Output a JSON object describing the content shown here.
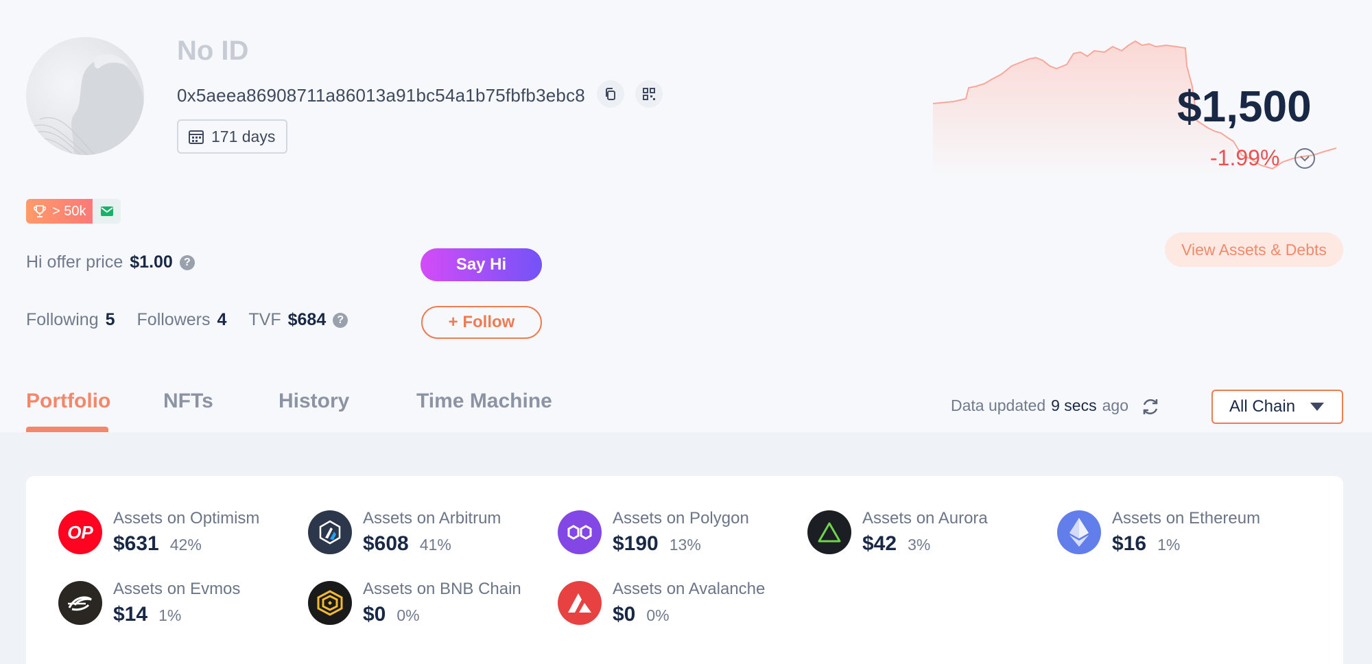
{
  "profile": {
    "name": "No ID",
    "address": "0x5aeea86908711a86013a91bc54a1b75fbfb3ebc8",
    "age": "171 days",
    "rank_badge": "> 50k"
  },
  "hi": {
    "label": "Hi offer price",
    "price": "$1.00",
    "button": "Say Hi"
  },
  "social": {
    "following_label": "Following",
    "following_count": "5",
    "followers_label": "Followers",
    "followers_count": "4",
    "tvf_label": "TVF",
    "tvf_value": "$684",
    "follow_button": "+ Follow"
  },
  "balance": {
    "total": "$1,500",
    "change": "-1.99%",
    "view_button": "View Assets & Debts"
  },
  "tabs": [
    {
      "label": "Portfolio",
      "active": true
    },
    {
      "label": "NFTs",
      "active": false
    },
    {
      "label": "History",
      "active": false
    },
    {
      "label": "Time Machine",
      "active": false
    }
  ],
  "status": {
    "prefix": "Data updated",
    "time": "9 secs",
    "suffix": "ago"
  },
  "chain_filter": {
    "selected": "All Chain"
  },
  "chains": [
    {
      "title": "Assets on Optimism",
      "amount": "$631",
      "pct": "42%",
      "icon": "optimism-logo",
      "color": "#ff0420"
    },
    {
      "title": "Assets on Arbitrum",
      "amount": "$608",
      "pct": "41%",
      "icon": "arbitrum-logo",
      "color": "#2d374b"
    },
    {
      "title": "Assets on Polygon",
      "amount": "$190",
      "pct": "13%",
      "icon": "polygon-logo",
      "color": "#8247e5"
    },
    {
      "title": "Assets on Aurora",
      "amount": "$42",
      "pct": "3%",
      "icon": "aurora-logo",
      "color": "#1b1f24"
    },
    {
      "title": "Assets on Ethereum",
      "amount": "$16",
      "pct": "1%",
      "icon": "ethereum-logo",
      "color": "#627eea"
    },
    {
      "title": "Assets on Evmos",
      "amount": "$14",
      "pct": "1%",
      "icon": "evmos-logo",
      "color": "#2a2622"
    },
    {
      "title": "Assets on BNB Chain",
      "amount": "$0",
      "pct": "0%",
      "icon": "bnb-logo",
      "color": "#1a1a1a"
    },
    {
      "title": "Assets on Avalanche",
      "amount": "$0",
      "pct": "0%",
      "icon": "avalanche-logo",
      "color": "#e84142"
    }
  ],
  "colors": {
    "accent": "#f4866a",
    "negative": "#ec4f4f",
    "say_hi_gradient": [
      "#d34cf7",
      "#7353f7"
    ]
  }
}
